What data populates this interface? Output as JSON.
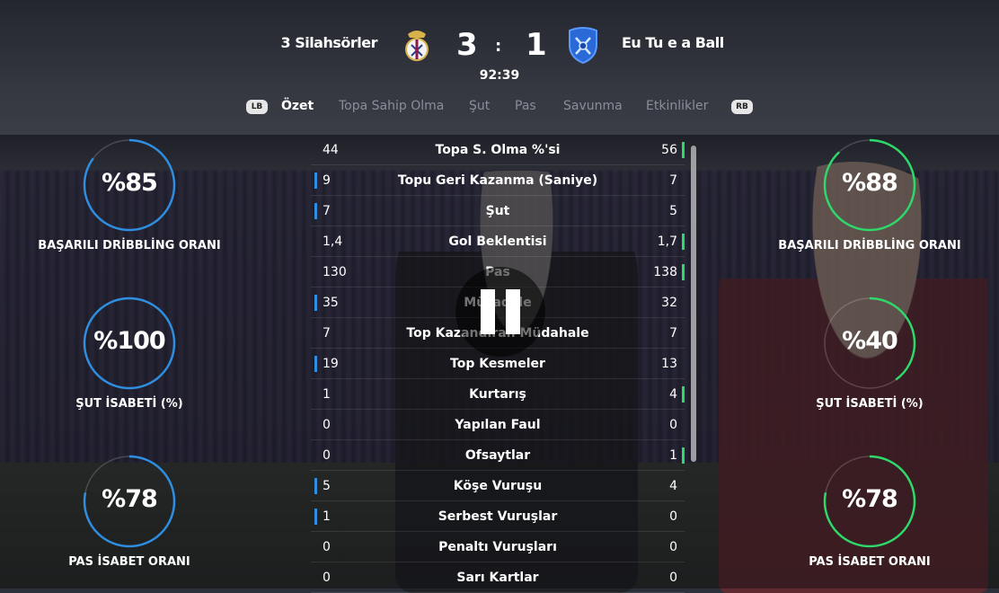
{
  "match": {
    "home_team": "3 Silahsörler",
    "away_team": "Eu Tu e a Ball",
    "home_score": "3",
    "separator": ":",
    "away_score": "1",
    "clock": "92:39",
    "home_color": "#2f8ee0",
    "away_color": "#2ed86a"
  },
  "tabs": {
    "lb": "LB",
    "rb": "RB",
    "items": [
      "Özet",
      "Topa Sahip Olma",
      "Şut",
      "Pas",
      "Savunma",
      "Etkinlikler"
    ],
    "active": "Özet"
  },
  "stats": [
    {
      "label": "Topa S. Olma %'si",
      "home": "44",
      "away": "56",
      "leader": "away"
    },
    {
      "label": "Topu Geri Kazanma (Saniye)",
      "home": "9",
      "away": "7",
      "leader": "home"
    },
    {
      "label": "Şut",
      "home": "7",
      "away": "5",
      "leader": "home"
    },
    {
      "label": "Gol Beklentisi",
      "home": "1,4",
      "away": "1,7",
      "leader": "away"
    },
    {
      "label": "Pas",
      "home": "130",
      "away": "138",
      "leader": "away"
    },
    {
      "label": "Mücadele",
      "home": "35",
      "away": "32",
      "leader": "home"
    },
    {
      "label": "Top Kazandıran Müdahale",
      "home": "7",
      "away": "7",
      "leader": "none"
    },
    {
      "label": "Top Kesmeler",
      "home": "19",
      "away": "13",
      "leader": "home"
    },
    {
      "label": "Kurtarış",
      "home": "1",
      "away": "4",
      "leader": "away"
    },
    {
      "label": "Yapılan Faul",
      "home": "0",
      "away": "0",
      "leader": "none"
    },
    {
      "label": "Ofsaytlar",
      "home": "0",
      "away": "1",
      "leader": "away"
    },
    {
      "label": "Köşe Vuruşu",
      "home": "5",
      "away": "4",
      "leader": "home"
    },
    {
      "label": "Serbest Vuruşlar",
      "home": "1",
      "away": "0",
      "leader": "home"
    },
    {
      "label": "Penaltı Vuruşları",
      "home": "0",
      "away": "0",
      "leader": "none"
    },
    {
      "label": "Sarı Kartlar",
      "home": "0",
      "away": "0",
      "leader": "none"
    }
  ],
  "gauges": {
    "home": [
      {
        "value": "%85",
        "percent": 85,
        "label": "BAŞARILI DRİBBLİNG ORANI"
      },
      {
        "value": "%100",
        "percent": 100,
        "label": "ŞUT İSABETİ (%)"
      },
      {
        "value": "%78",
        "percent": 78,
        "label": "PAS İSABET ORANI"
      }
    ],
    "away": [
      {
        "value": "%88",
        "percent": 88,
        "label": "BAŞARILI DRİBBLİNG ORANI"
      },
      {
        "value": "%40",
        "percent": 40,
        "label": "ŞUT İSABETİ (%)"
      },
      {
        "value": "%78",
        "percent": 78,
        "label": "PAS İSABET ORANI"
      }
    ]
  },
  "icons": {
    "pause": "pause-icon",
    "home_crest": "real-madrid-crest-icon",
    "away_crest": "shield-crest-icon"
  }
}
